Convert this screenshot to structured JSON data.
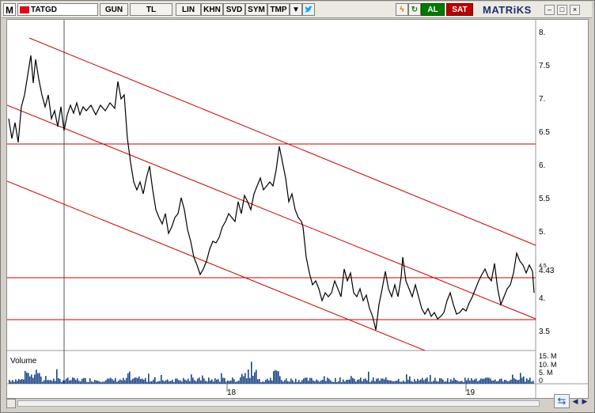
{
  "toolbar": {
    "app_letter": "M",
    "symbol": "TATGD",
    "period": "GUN",
    "currency": "TL",
    "scale": "LIN",
    "buttons": [
      "KHN",
      "SVD",
      "SYM",
      "TMP"
    ],
    "buy_label": "AL",
    "sell_label": "SAT",
    "brand": "MATRiKS",
    "colors": {
      "buy": "#007a00",
      "sell": "#b40000",
      "brand": "#1c2f6e",
      "twitter": "#1da1f2"
    }
  },
  "chart": {
    "price_axis_ticks": [
      "8.",
      "7.5",
      "7.",
      "6.5",
      "6.",
      "5.5",
      "5.",
      "4.5",
      "4.",
      "3.5"
    ],
    "last_price": "4.43",
    "volume_label": "Volume",
    "volume_axis_ticks": [
      "15. M",
      "10. M",
      "5. M",
      "0"
    ],
    "time_labels": [
      "18",
      "19"
    ],
    "colors": {
      "price_line": "#000000",
      "trend_lines": "#cc0000",
      "volume": "#1a4488",
      "background": "#ffffff"
    }
  },
  "chart_data": {
    "type": "line",
    "ylim": [
      3.2,
      8.1
    ],
    "x": [
      "2017-03",
      "2017-06",
      "2017-09",
      "2017-12",
      "2018-01",
      "2018-04",
      "2018-07",
      "2018-10",
      "2019-01",
      "2019-04",
      "2019-05"
    ],
    "series": [
      {
        "values": [
          6.8,
          7.9,
          6.9,
          7.1,
          6.6,
          5.4,
          4.4,
          5.6,
          6.2,
          3.8,
          4.43
        ]
      }
    ],
    "horizontal_levels": [
      6.33,
      4.3,
      3.65
    ],
    "volume_ylim": [
      0,
      15000000
    ]
  }
}
